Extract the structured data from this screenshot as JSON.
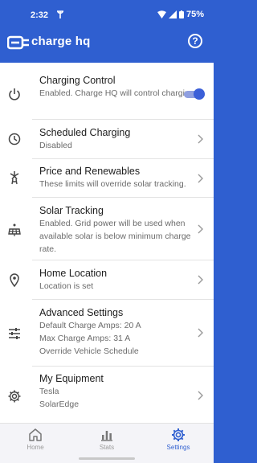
{
  "status_bar": {
    "time": "2:32",
    "battery": "75%"
  },
  "app_bar": {
    "title": "charge hq",
    "help_glyph": "?"
  },
  "settings": [
    {
      "title": "Charging Control",
      "subtitle": "Enabled. Charge HQ will control charging.",
      "icon": "power-icon",
      "control": "toggle",
      "toggle_on": true
    },
    {
      "title": "Scheduled Charging",
      "subtitle": "Disabled",
      "icon": "clock-icon",
      "control": "chevron"
    },
    {
      "title": "Price and Renewables",
      "subtitle": "These limits will override solar tracking.",
      "icon": "wind-turbine-icon",
      "control": "chevron"
    },
    {
      "title": "Solar Tracking",
      "subtitle": "Enabled. Grid power will be used when available solar is below minimum charge rate.",
      "icon": "solar-panel-icon",
      "control": "chevron"
    },
    {
      "title": "Home Location",
      "subtitle": "Location is set",
      "icon": "location-pin-icon",
      "control": "chevron"
    },
    {
      "title": "Advanced Settings",
      "subtitle_lines": [
        "Default Charge Amps: 20 A",
        "Max Charge Amps: 31 A",
        "Override Vehicle Schedule"
      ],
      "icon": "sliders-icon",
      "control": "chevron"
    },
    {
      "title": "My Equipment",
      "subtitle_lines": [
        "Tesla",
        "SolarEdge"
      ],
      "icon": "gear-icon",
      "control": "chevron"
    }
  ],
  "bottom_nav": [
    {
      "label": "Home",
      "icon": "home-icon",
      "active": false
    },
    {
      "label": "Stats",
      "icon": "bar-chart-icon",
      "active": false
    },
    {
      "label": "Settings",
      "icon": "settings-gear-icon",
      "active": true
    }
  ],
  "colors": {
    "brand_blue": "#2f5fd0",
    "toggle_on": "#3b5fd8",
    "active_nav": "#2f5fd0"
  }
}
